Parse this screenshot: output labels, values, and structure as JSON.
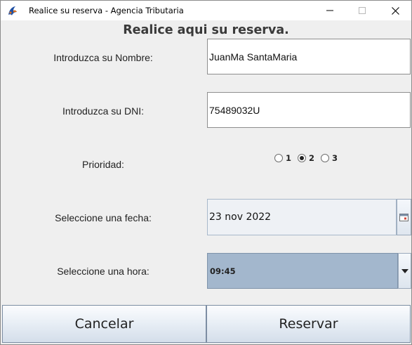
{
  "window": {
    "title": "Realice su reserva - Agencia Tributaria"
  },
  "form": {
    "heading": "Realice aqui su reserva.",
    "name_label": "Introduzca su Nombre:",
    "name_value": "JuanMa SantaMaria",
    "dni_label": "Introduzca su DNI:",
    "dni_value": "75489032U",
    "priority_label": "Prioridad:",
    "priority_options": [
      "1",
      "2",
      "3"
    ],
    "priority_selected": "2",
    "date_label": "Seleccione una fecha:",
    "date_value": "23 nov 2022",
    "time_label": "Seleccione una hora:",
    "time_value": "09:45"
  },
  "buttons": {
    "cancel": "Cancelar",
    "reserve": "Reservar"
  },
  "icons": {
    "app": "java-app-icon",
    "calendar": "calendar-icon",
    "dropdown": "chevron-down-icon"
  },
  "colors": {
    "combo_selected_bg": "#a3b7cd",
    "window_bg": "#efefef"
  }
}
